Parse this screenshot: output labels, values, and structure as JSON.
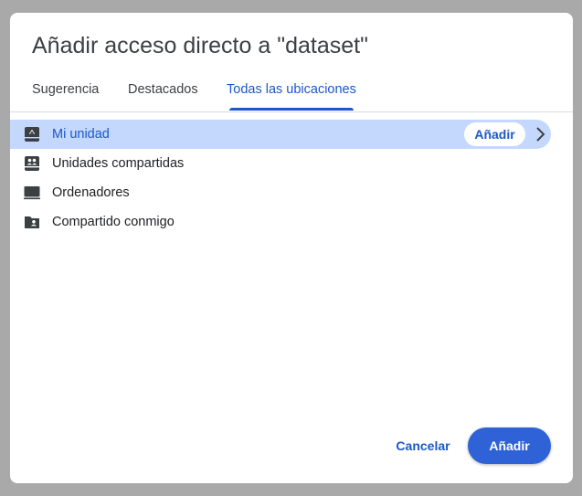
{
  "dialog": {
    "title": "Añadir acceso directo a \"dataset\""
  },
  "tabs": [
    {
      "label": "Sugerencia",
      "active": false
    },
    {
      "label": "Destacados",
      "active": false
    },
    {
      "label": "Todas las ubicaciones",
      "active": true
    }
  ],
  "locations": [
    {
      "label": "Mi unidad",
      "icon": "my-drive-icon",
      "selected": true,
      "action_label": "Añadir"
    },
    {
      "label": "Unidades compartidas",
      "icon": "shared-drives-icon",
      "selected": false
    },
    {
      "label": "Ordenadores",
      "icon": "computer-icon",
      "selected": false
    },
    {
      "label": "Compartido conmigo",
      "icon": "shared-folder-icon",
      "selected": false
    }
  ],
  "footer": {
    "cancel_label": "Cancelar",
    "add_label": "Añadir"
  },
  "colors": {
    "accent": "#1a57c9",
    "primary_button": "#2e62d6",
    "selected_row": "#c4d8fd",
    "overlay": "#a9a9a9"
  }
}
